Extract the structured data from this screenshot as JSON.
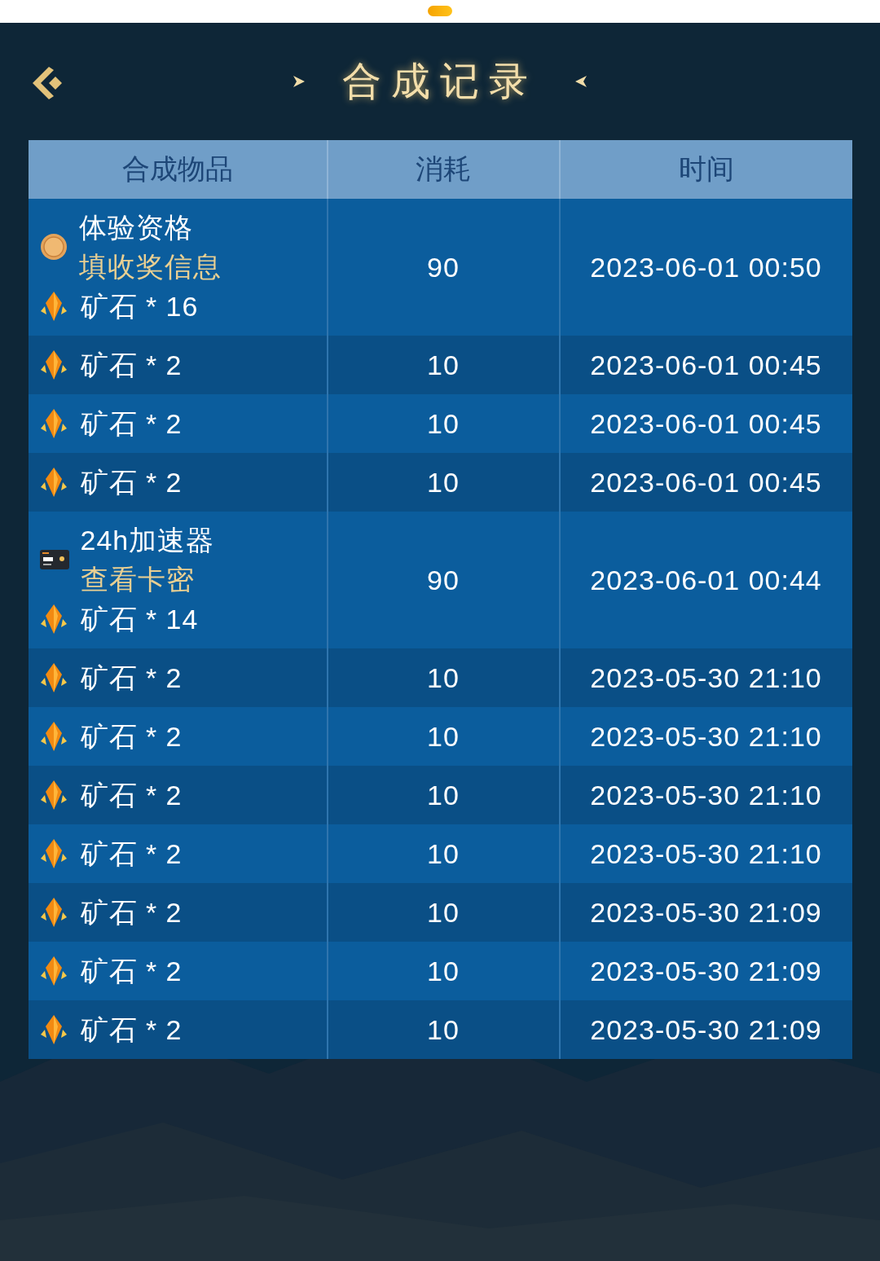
{
  "header": {
    "title": "合成记录"
  },
  "table": {
    "columns": [
      "合成物品",
      "消耗",
      "时间"
    ],
    "rows": [
      {
        "kind": "badge-prize",
        "prize": "体验资格",
        "action": "填收奖信息",
        "item": "矿石 * 16",
        "cost": "90",
        "time": "2023-06-01 00:50"
      },
      {
        "kind": "ore",
        "item": "矿石 * 2",
        "cost": "10",
        "time": "2023-06-01 00:45"
      },
      {
        "kind": "ore",
        "item": "矿石 * 2",
        "cost": "10",
        "time": "2023-06-01 00:45"
      },
      {
        "kind": "ore",
        "item": "矿石 * 2",
        "cost": "10",
        "time": "2023-06-01 00:45"
      },
      {
        "kind": "card-prize",
        "prize": "24h加速器",
        "action": "查看卡密",
        "item": "矿石 * 14",
        "cost": "90",
        "time": "2023-06-01 00:44"
      },
      {
        "kind": "ore",
        "item": "矿石 * 2",
        "cost": "10",
        "time": "2023-05-30 21:10"
      },
      {
        "kind": "ore",
        "item": "矿石 * 2",
        "cost": "10",
        "time": "2023-05-30 21:10"
      },
      {
        "kind": "ore",
        "item": "矿石 * 2",
        "cost": "10",
        "time": "2023-05-30 21:10"
      },
      {
        "kind": "ore",
        "item": "矿石 * 2",
        "cost": "10",
        "time": "2023-05-30 21:10"
      },
      {
        "kind": "ore",
        "item": "矿石 * 2",
        "cost": "10",
        "time": "2023-05-30 21:09"
      },
      {
        "kind": "ore",
        "item": "矿石 * 2",
        "cost": "10",
        "time": "2023-05-30 21:09"
      },
      {
        "kind": "ore",
        "item": "矿石 * 2",
        "cost": "10",
        "time": "2023-05-30 21:09"
      }
    ]
  }
}
